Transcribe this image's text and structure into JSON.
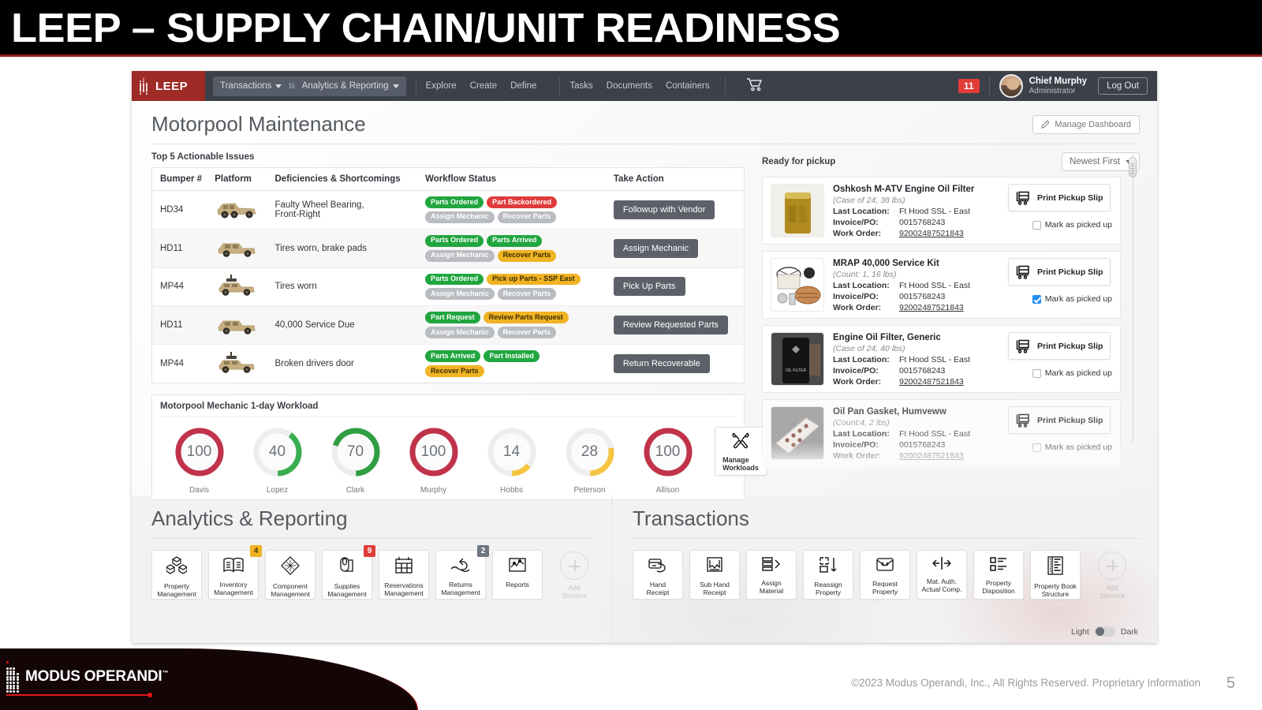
{
  "slide": {
    "title": "LEEP – SUPPLY CHAIN/UNIT READINESS",
    "copyright": "©2023  Modus Operandi, Inc., All Rights Reserved.  Proprietary Information",
    "page_number": "5",
    "footer_brand": "MODUS OPERANDI",
    "footer_brand_tm": "™"
  },
  "topnav": {
    "brand": "LEEP",
    "pill": {
      "transactions": "Transactions",
      "separator_text": "tii",
      "analytics": "Analytics & Reporting"
    },
    "links": [
      "Explore",
      "Create",
      "Define"
    ],
    "links2": [
      "Tasks",
      "Documents",
      "Containers"
    ],
    "cart_icon": "shopping-cart-icon",
    "notification_count": "11",
    "user_name": "Chief Murphy",
    "user_role": "Administrator",
    "logout_label": "Log Out"
  },
  "dashboard": {
    "title": "Motorpool Maintenance",
    "manage_button": "Manage Dashboard",
    "issues_label": "Top 5 Actionable Issues",
    "workload_label": "Motorpool Mechanic 1-day Workload",
    "pickup_label": "Ready for pickup",
    "pickup_sort": "Newest First"
  },
  "issues": {
    "columns": [
      "Bumper #",
      "Platform",
      "Deficiencies & Shortcomings",
      "Workflow Status",
      "Take Action"
    ],
    "rows": [
      {
        "bumper": "HD34",
        "platform_icon": "mrap-vehicle-icon",
        "deficiency": "Faulty Wheel Bearing, Front-Right",
        "chips": [
          {
            "label": "Parts Ordered",
            "state": "green"
          },
          {
            "label": "Part Backordered",
            "state": "red"
          },
          {
            "label": "Assign Mechanic",
            "state": "grey"
          },
          {
            "label": "Recover Parts",
            "state": "grey"
          }
        ],
        "action": "Followup with Vendor"
      },
      {
        "bumper": "HD11",
        "platform_icon": "humvee-vehicle-icon",
        "deficiency": "Tires worn, brake pads",
        "chips": [
          {
            "label": "Parts Ordered",
            "state": "green"
          },
          {
            "label": "Parts Arrived",
            "state": "green"
          },
          {
            "label": "Assign Mechanic",
            "state": "grey"
          },
          {
            "label": "Recover Parts",
            "state": "amber"
          }
        ],
        "action": "Assign Mechanic"
      },
      {
        "bumper": "MP44",
        "platform_icon": "gun-truck-vehicle-icon",
        "deficiency": "Tires worn",
        "chips": [
          {
            "label": "Parts Ordered",
            "state": "green"
          },
          {
            "label": "Pick up Parts - SSP East",
            "state": "amber"
          },
          {
            "label": "Assign Mechanic",
            "state": "grey"
          },
          {
            "label": "Recover Parts",
            "state": "grey"
          }
        ],
        "action": "Pick Up Parts"
      },
      {
        "bumper": "HD11",
        "platform_icon": "humvee-vehicle-icon",
        "deficiency": "40,000 Service Due",
        "chips": [
          {
            "label": "Part Request",
            "state": "green"
          },
          {
            "label": "Review Parts Request",
            "state": "amber"
          },
          {
            "label": "Assign Mechanic",
            "state": "grey"
          },
          {
            "label": "Recover Parts",
            "state": "grey"
          }
        ],
        "action": "Review Requested Parts"
      },
      {
        "bumper": "MP44",
        "platform_icon": "gun-truck-vehicle-icon",
        "deficiency": "Broken drivers door",
        "chips": [
          {
            "label": "Parts Arrived",
            "state": "green"
          },
          {
            "label": "Part Installed",
            "state": "green"
          },
          {
            "label": "Recover Parts",
            "state": "amber"
          }
        ],
        "action": "Return Recoverable"
      }
    ]
  },
  "workload": {
    "gauges": [
      {
        "name": "Davis",
        "value": "100",
        "percent": 100,
        "color": "#c0334a"
      },
      {
        "name": "Lopez",
        "value": "40",
        "percent": 40,
        "color": "#3aad50"
      },
      {
        "name": "Clark",
        "value": "70",
        "percent": 70,
        "color": "#2f9e42"
      },
      {
        "name": "Murphy",
        "value": "100",
        "percent": 100,
        "color": "#c0334a"
      },
      {
        "name": "Hobbs",
        "value": "14",
        "percent": 14,
        "color": "#f5c542"
      },
      {
        "name": "Peterson",
        "value": "28",
        "percent": 28,
        "color": "#f5c542"
      },
      {
        "name": "Allison",
        "value": "100",
        "percent": 100,
        "color": "#c0334a"
      }
    ],
    "manage_button_line1": "Manage",
    "manage_button_line2": "Workloads",
    "manage_icon": "wrench-screwdriver-icon"
  },
  "pickup": {
    "labels": {
      "last_location": "Last Location:",
      "invoice": "Invoice/PO:",
      "work_order": "Work Order:",
      "print": "Print Pickup Slip",
      "mark": "Mark as picked up"
    },
    "items": [
      {
        "name": "Oshkosh M-ATV Engine Oil Filter",
        "sub": "(Case of 24, 38 lbs)",
        "location": "Ft Hood SSL - East",
        "invoice": "0015768243",
        "work_order": "92002487521843",
        "checked": false,
        "thumb": "oil-filter-photo"
      },
      {
        "name": "MRAP 40,000 Service Kit",
        "sub": "(Count: 1, 16 lbs)",
        "location": "Ft Hood SSL - East",
        "invoice": "0015768243",
        "work_order": "92002487521843",
        "checked": true,
        "thumb": "service-kit-photo"
      },
      {
        "name": "Engine Oil Filter, Generic",
        "sub": "(Case of 24, 40 lbs)",
        "location": "Ft Hood SSL - East",
        "invoice": "0015768243",
        "work_order": "92002487521843",
        "checked": false,
        "thumb": "generic-oil-filter-photo"
      },
      {
        "name": "Oil Pan Gasket, Humveww",
        "sub": "(Count:4, 2 lbs)",
        "location": "Ft Hood SSL - East",
        "invoice": "0015768243",
        "work_order": "92002487521843",
        "checked": false,
        "thumb": "oil-pan-gasket-photo"
      }
    ]
  },
  "analytics_panel": {
    "title": "Analytics & Reporting",
    "add_shortcut_line1": "Add",
    "add_shortcut_line2": "Shortcut",
    "tiles": [
      {
        "label": "Property\nManagement",
        "icon": "boxes-icon",
        "badge": null,
        "badge_color": null
      },
      {
        "label": "Inventory\nManagement",
        "icon": "open-book-icon",
        "badge": "4",
        "badge_color": "amber"
      },
      {
        "label": "Component\nManagement",
        "icon": "diamond-grid-icon",
        "badge": null,
        "badge_color": null
      },
      {
        "label": "Supplies\nManagement",
        "icon": "paper-roll-icon",
        "badge": "9",
        "badge_color": "red"
      },
      {
        "label": "Reservations\nManagement",
        "icon": "calendar-icon",
        "badge": null,
        "badge_color": null
      },
      {
        "label": "Returns\nManagement",
        "icon": "hand-return-icon",
        "badge": "2",
        "badge_color": "grey"
      },
      {
        "label": "Reports",
        "icon": "chart-report-icon",
        "badge": null,
        "badge_color": null
      }
    ]
  },
  "transactions_panel": {
    "title": "Transactions",
    "add_shortcut_line1": "Add",
    "add_shortcut_line2": "Shortcut",
    "tiles": [
      {
        "label": "Hand\nReceipt",
        "icon": "hand-receipt-icon"
      },
      {
        "label": "Sub Hand\nReceipt",
        "icon": "sub-hand-receipt-icon"
      },
      {
        "label": "Assign\nMaterial",
        "icon": "assign-material-icon"
      },
      {
        "label": "Reassign\nProperty",
        "icon": "reassign-property-icon"
      },
      {
        "label": "Request\nProperty",
        "icon": "request-property-icon"
      },
      {
        "label": "Mat. Auth.\nActual Comp.",
        "icon": "compare-arrows-icon"
      },
      {
        "label": "Property\nDisposition",
        "icon": "property-disposition-icon"
      },
      {
        "label": "Property Book\nStructure",
        "icon": "property-book-structure-icon"
      }
    ]
  },
  "theme": {
    "light_label": "Light",
    "dark_label": "Dark"
  }
}
